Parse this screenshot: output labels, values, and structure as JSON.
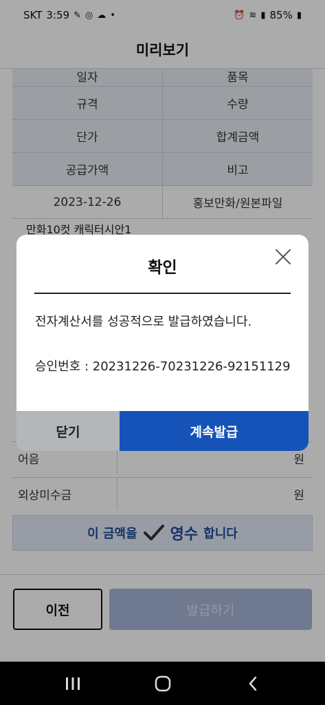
{
  "status_bar": {
    "carrier": "SKT",
    "time": "3:59",
    "battery": "85%"
  },
  "header": {
    "title": "미리보기"
  },
  "table": {
    "row_partial_top": [
      "일자",
      "품목"
    ],
    "header_rows": [
      [
        "규격",
        "수량"
      ],
      [
        "단가",
        "합계금액"
      ],
      [
        "공급가액",
        "비고"
      ]
    ],
    "data_row": [
      "2023-12-26",
      "홍보만화/원본파일"
    ],
    "partial_text": "만화10컷 캐릭터시안1"
  },
  "summary": [
    {
      "label": "어음",
      "unit": "원"
    },
    {
      "label": "외상미수금",
      "unit": "원"
    }
  ],
  "receipt": {
    "prefix": "이 금액을",
    "strong": "영수",
    "suffix": "합니다"
  },
  "buttons": {
    "prev": "이전",
    "issue": "발급하기"
  },
  "modal": {
    "title": "확인",
    "message": "전자계산서를 성공적으로 발급하였습니다.",
    "approval": "승인번호 : 20231226-70231226-92151129",
    "close": "닫기",
    "continue": "계속발급"
  },
  "colors": {
    "primary": "#1553b8",
    "receipt_text": "#1e4c96",
    "disabled": "#a6b7d8"
  }
}
